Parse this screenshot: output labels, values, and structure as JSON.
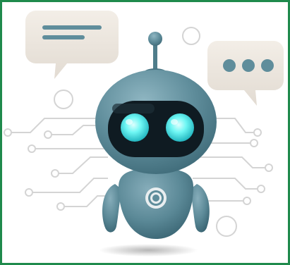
{
  "image": {
    "subject": "robot-chatbot-illustration",
    "colors": {
      "frame_border": "#1f8a4c",
      "background": "#ffffff",
      "robot_body": "#5f8d9b",
      "robot_body_dark": "#3f6b79",
      "robot_face": "#0f1b22",
      "robot_eyes": "#5ef2f0",
      "speech_bubble": "#ece6de",
      "bubble_accent": "#5f8d9b",
      "circuit_lines": "#d2d2d2"
    },
    "icons": [
      "speech-bubble-lines-icon",
      "speech-bubble-dots-icon",
      "robot-icon",
      "target-icon",
      "antenna-icon"
    ]
  }
}
